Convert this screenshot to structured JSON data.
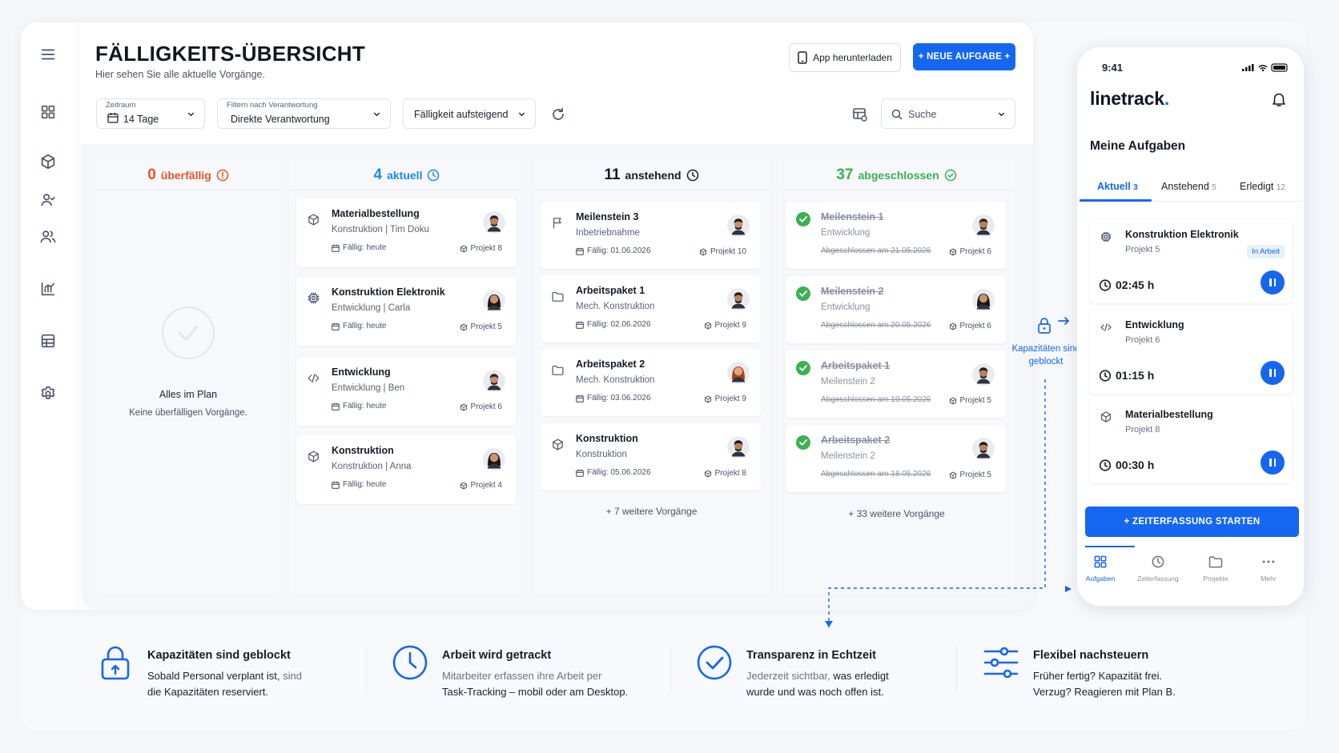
{
  "header": {
    "title": "FÄLLIGKEITS-ÜBERSICHT",
    "subtitle": "Hier sehen Sie alle aktuelle Vorgänge.",
    "app_button": "App herunterladen",
    "new_task_button": "+ NEUE AUFGABE +"
  },
  "filters": {
    "period_label": "Zeitraum",
    "period_value": "14 Tage",
    "responsibility_label": "Filtern nach Verantwortung",
    "responsibility_value": "Direkte Verantwortung",
    "sort_value": "Fälligkeit aufsteigend",
    "search_placeholder": "Suche"
  },
  "colors": {
    "accent": "#1566f0",
    "overdue": "#e8542a",
    "current": "#1e8be6",
    "done": "#3bb055"
  },
  "columns": {
    "overdue": {
      "count": "0",
      "label": "überfällig",
      "empty_title": "Alles im Plan",
      "empty_text": "Keine überfälligen Vorgänge."
    },
    "current": {
      "count": "4",
      "label": "aktuell",
      "cards": [
        {
          "icon": "cube-icon",
          "title": "Materialbestellung",
          "sub": "Konstruktion | Tim Doku",
          "due": "Fällig: heute",
          "project": "Projekt 8"
        },
        {
          "icon": "chip-icon",
          "title": "Konstruktion Elektronik",
          "sub": "Entwicklung | Carla",
          "due": "Fällig: heute",
          "project": "Projekt 5"
        },
        {
          "icon": "code-icon",
          "title": "Entwicklung",
          "sub": "Entwicklung | Ben",
          "due": "Fällig: heute",
          "project": "Projekt 6"
        },
        {
          "icon": "cube-icon",
          "title": "Konstruktion",
          "sub": "Konstruktion | Anna",
          "due": "Fällig: heute",
          "project": "Projekt 4"
        }
      ]
    },
    "upcoming": {
      "count": "11",
      "label": "anstehend",
      "cards": [
        {
          "icon": "flag-icon",
          "title": "Meilenstein 3",
          "sub": "Inbetriebnahme",
          "due": "Fällig: 01.06.2026",
          "project": "Projekt 10"
        },
        {
          "icon": "folder-icon",
          "title": "Arbeitspaket 1",
          "sub": "Mech. Konstruktion",
          "due": "Fällig: 02.06.2026",
          "project": "Projekt 9"
        },
        {
          "icon": "folder-icon",
          "title": "Arbeitspaket 2",
          "sub": "Mech. Konstruktion",
          "due": "Fällig: 03.06.2026",
          "project": "Projekt 9"
        },
        {
          "icon": "cube-icon",
          "title": "Konstruktion",
          "sub": "Konstruktion",
          "due": "Fällig: 05.06.2026",
          "project": "Projekt 8"
        }
      ],
      "more": "+ 7 weitere Vorgänge"
    },
    "done": {
      "count": "37",
      "label": "abgeschlossen",
      "cards": [
        {
          "title": "Meilenstein 1",
          "sub": "Entwicklung",
          "due": "Abgeschlossen am 21.05.2026",
          "project": "Projekt 6"
        },
        {
          "title": "Meilenstein 2",
          "sub": "Entwicklung",
          "due": "Abgeschlossen am 20.05.2026",
          "project": "Projekt 6"
        },
        {
          "title": "Arbeitspaket 1",
          "sub": "Meilenstein 2",
          "due": "Abgeschlossen am 19.05.2026",
          "project": "Projekt 5"
        },
        {
          "title": "Arbeitspaket 2",
          "sub": "Meilenstein 2",
          "due": "Abgeschlossen am 18.05.2026",
          "project": "Projekt 5"
        }
      ],
      "more": "+ 33 weitere Vorgänge"
    }
  },
  "callout": {
    "line1": "Kapazitäten sind",
    "line2": "geblockt"
  },
  "phone": {
    "time": "9:41",
    "brand": "linetrack",
    "heading": "Meine Aufgaben",
    "tabs": [
      {
        "label": "Aktuell",
        "count": "3"
      },
      {
        "label": "Anstehend",
        "count": "5"
      },
      {
        "label": "Erledigt",
        "count": "12"
      }
    ],
    "tasks": [
      {
        "icon": "chip-icon",
        "title": "Konstruktion Elektronik",
        "project": "Projekt 5",
        "badge": "In Arbeit",
        "time": "02:45 h"
      },
      {
        "icon": "code-icon",
        "title": "Entwicklung",
        "project": "Projekt 6",
        "badge": "",
        "time": "01:15 h"
      },
      {
        "icon": "cube-icon",
        "title": "Materialbestellung",
        "project": "Projekt 8",
        "badge": "",
        "time": "00:30 h"
      }
    ],
    "start_button": "+ ZEITERFASSUNG STARTEN",
    "nav": [
      "Aufgaben",
      "Zeiterfassung",
      "Projekte",
      "Mehr"
    ]
  },
  "features": [
    {
      "icon": "lock-icon",
      "title": "Kapazitäten sind geblockt",
      "line1a": "Sobald Personal verplant ist,",
      "line1b": " sind",
      "line2": "die Kapazitäten reserviert."
    },
    {
      "icon": "clock-icon",
      "title": "Arbeit wird getrackt",
      "line1a": "Mitarbeiter erfassen ihre Arbeit per",
      "line1b": "",
      "line2": "Task-Tracking – mobil oder am Desktop."
    },
    {
      "icon": "check-icon",
      "title": "Transparenz in Echtzeit",
      "line1a": "Jederzeit sichtbar,",
      "line1b": " was erledigt",
      "line2": "wurde und was noch offen ist."
    },
    {
      "icon": "sliders-icon",
      "title": "Flexibel nachsteuern",
      "line1a": "Früher fertig? Kapazität frei.",
      "line1b": "",
      "line2": "Verzug? Reagieren mit Plan B."
    }
  ]
}
